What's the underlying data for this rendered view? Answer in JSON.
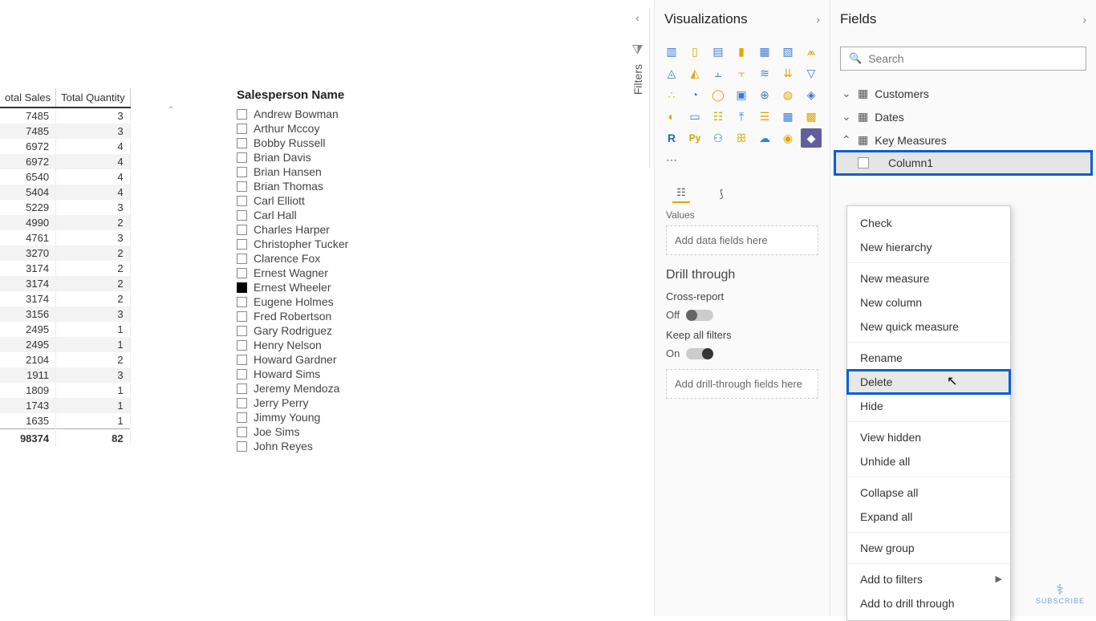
{
  "table": {
    "columns": [
      "otal Sales",
      "Total Quantity"
    ],
    "rows": [
      [
        7485,
        3
      ],
      [
        7485,
        3
      ],
      [
        6972,
        4
      ],
      [
        6972,
        4
      ],
      [
        6540,
        4
      ],
      [
        5404,
        4
      ],
      [
        5229,
        3
      ],
      [
        4990,
        2
      ],
      [
        4761,
        3
      ],
      [
        3270,
        2
      ],
      [
        3174,
        2
      ],
      [
        3174,
        2
      ],
      [
        3174,
        2
      ],
      [
        3156,
        3
      ],
      [
        2495,
        1
      ],
      [
        2495,
        1
      ],
      [
        2104,
        2
      ],
      [
        1911,
        3
      ],
      [
        1809,
        1
      ],
      [
        1743,
        1
      ],
      [
        1635,
        1
      ]
    ],
    "totals": [
      98374,
      82
    ]
  },
  "slicer": {
    "title": "Salesperson Name",
    "items": [
      {
        "name": "Andrew Bowman",
        "checked": false
      },
      {
        "name": "Arthur Mccoy",
        "checked": false
      },
      {
        "name": "Bobby Russell",
        "checked": false
      },
      {
        "name": "Brian Davis",
        "checked": false
      },
      {
        "name": "Brian Hansen",
        "checked": false
      },
      {
        "name": "Brian Thomas",
        "checked": false
      },
      {
        "name": "Carl Elliott",
        "checked": false
      },
      {
        "name": "Carl Hall",
        "checked": false
      },
      {
        "name": "Charles Harper",
        "checked": false
      },
      {
        "name": "Christopher Tucker",
        "checked": false
      },
      {
        "name": "Clarence Fox",
        "checked": false
      },
      {
        "name": "Ernest Wagner",
        "checked": false
      },
      {
        "name": "Ernest Wheeler",
        "checked": true
      },
      {
        "name": "Eugene Holmes",
        "checked": false
      },
      {
        "name": "Fred Robertson",
        "checked": false
      },
      {
        "name": "Gary Rodriguez",
        "checked": false
      },
      {
        "name": "Henry Nelson",
        "checked": false
      },
      {
        "name": "Howard Gardner",
        "checked": false
      },
      {
        "name": "Howard Sims",
        "checked": false
      },
      {
        "name": "Jeremy Mendoza",
        "checked": false
      },
      {
        "name": "Jerry Perry",
        "checked": false
      },
      {
        "name": "Jimmy Young",
        "checked": false
      },
      {
        "name": "Joe Sims",
        "checked": false
      },
      {
        "name": "John Reyes",
        "checked": false
      }
    ]
  },
  "filters_pane": {
    "label": "Filters"
  },
  "viz": {
    "title": "Visualizations",
    "section_values": "Values",
    "values_placeholder": "Add data fields here",
    "drill_header": "Drill through",
    "cross_report_label": "Cross-report",
    "cross_report_state": "Off",
    "keep_filters_label": "Keep all filters",
    "keep_filters_state": "On",
    "drill_placeholder": "Add drill-through fields here"
  },
  "fields": {
    "title": "Fields",
    "search_placeholder": "Search",
    "tables": [
      {
        "name": "Customers",
        "expanded": false
      },
      {
        "name": "Dates",
        "expanded": false
      },
      {
        "name": "Key Measures",
        "expanded": true,
        "selected_field": "Column1"
      }
    ]
  },
  "context_menu": {
    "items": [
      "Check",
      "New hierarchy",
      "---",
      "New measure",
      "New column",
      "New quick measure",
      "---",
      "Rename",
      "Delete",
      "Hide",
      "---",
      "View hidden",
      "Unhide all",
      "---",
      "Collapse all",
      "Expand all",
      "---",
      "New group",
      "---",
      "Add to filters",
      "Add to drill through"
    ],
    "highlighted": "Delete",
    "has_submenu": [
      "Add to filters"
    ]
  },
  "subscribe_label": "SUBSCRIBE"
}
